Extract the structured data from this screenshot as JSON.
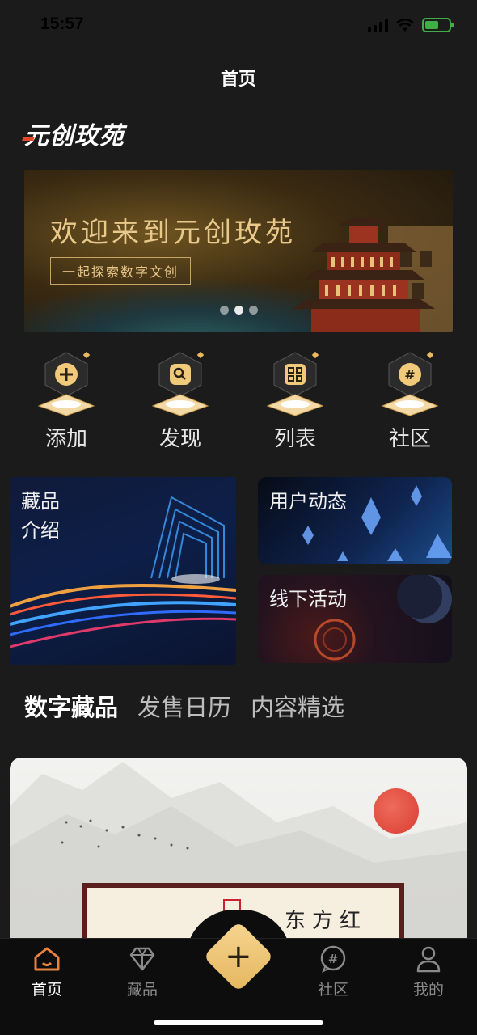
{
  "status_bar": {
    "time": "15:57"
  },
  "nav": {
    "title": "首页"
  },
  "logo": {
    "text": "元创玫苑"
  },
  "banner": {
    "title": "欢迎来到元创玫苑",
    "subtitle": "一起探索数字文创",
    "pagination": {
      "count": 3,
      "active_index": 1
    }
  },
  "actions": [
    {
      "label": "添加",
      "icon": "plus-icon"
    },
    {
      "label": "发现",
      "icon": "search-icon"
    },
    {
      "label": "列表",
      "icon": "grid-icon"
    },
    {
      "label": "社区",
      "icon": "hash-icon"
    }
  ],
  "cards": {
    "collection_intro": {
      "line1": "藏品",
      "line2": "介绍"
    },
    "user_activity": {
      "label": "用户动态"
    },
    "offline_events": {
      "label": "线下活动"
    }
  },
  "tabs": [
    {
      "label": "数字藏品",
      "active": true
    },
    {
      "label": "发售日历",
      "active": false
    },
    {
      "label": "内容精选",
      "active": false
    }
  ],
  "feature": {
    "frame_text": "东方红"
  },
  "tabbar": [
    {
      "label": "首页",
      "icon": "home-icon",
      "active": true
    },
    {
      "label": "藏品",
      "icon": "diamond-icon",
      "active": false
    },
    {
      "label": "",
      "icon": "plus-icon",
      "active": false
    },
    {
      "label": "社区",
      "icon": "hash-icon",
      "active": false
    },
    {
      "label": "我的",
      "icon": "user-icon",
      "active": false
    }
  ],
  "colors": {
    "accent": "#e5b65e",
    "home_active": "#e8823f",
    "background": "#1b1b1b"
  }
}
